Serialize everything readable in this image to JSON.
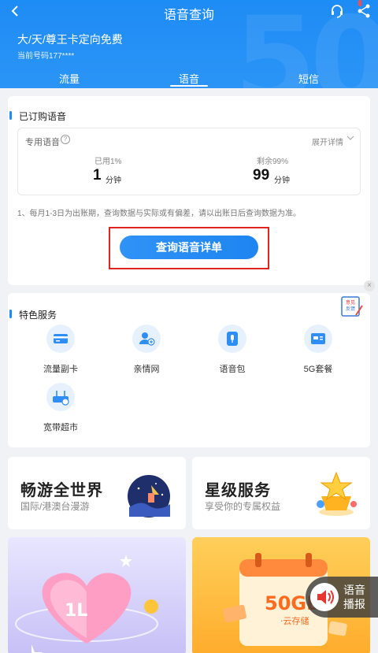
{
  "header": {
    "title": "语音查询",
    "badge": "",
    "plan_name": "大/天/尊王卡定向免费",
    "plan_arrow": "›",
    "phone_line": "当前号码177****",
    "deco_text": "50"
  },
  "tabs": [
    {
      "label": "流量"
    },
    {
      "label": "语音"
    },
    {
      "label": "短信"
    }
  ],
  "subscribed": {
    "section_title": "已订购语音",
    "voice_label": "专用语音",
    "help": "?",
    "expand_label": "展开详情",
    "used_label": "已用1%",
    "used_value": "1",
    "used_unit": "分钟",
    "remain_label": "剩余99%",
    "remain_value": "99",
    "remain_unit": "分钟",
    "note": "1、每月1-3日为出账期，查询数据与实际或有偏差，请以出账日后查询数据为准。",
    "query_button": "查询语音详单"
  },
  "services": {
    "section_title": "特色服务",
    "feedback_label": "意见反馈",
    "items": [
      {
        "label": "流量副卡",
        "icon": "card-icon"
      },
      {
        "label": "亲情网",
        "icon": "family-icon"
      },
      {
        "label": "语音包",
        "icon": "microphone-icon"
      },
      {
        "label": "5G套餐",
        "icon": "5g-card-icon"
      },
      {
        "label": "宽带超市",
        "icon": "router-icon"
      }
    ]
  },
  "promos": [
    {
      "title": "畅游全世界",
      "subtitle": "国际/港澳台漫游"
    },
    {
      "title": "星级服务",
      "subtitle": "享受你的专属权益"
    }
  ],
  "banners": {
    "left_text": "1L",
    "right_big": "50GB",
    "right_small": "·云存储"
  },
  "voice_broadcast": {
    "label_line1": "语音",
    "label_line2": "播报"
  },
  "colors": {
    "brand_blue": "#1e8cf5",
    "highlight_red": "#e0241f"
  }
}
